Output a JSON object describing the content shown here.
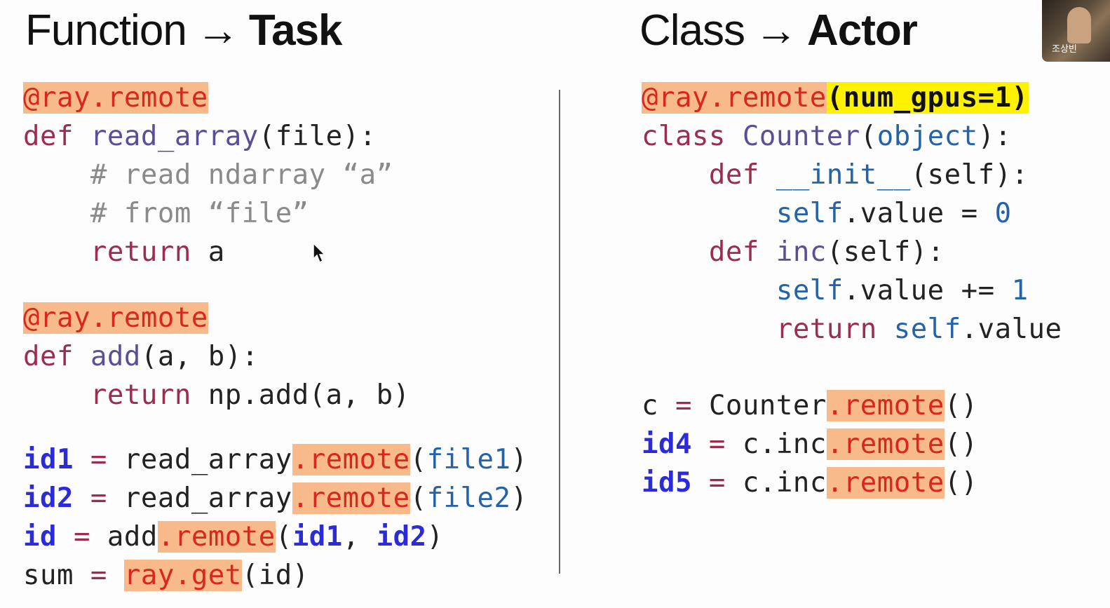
{
  "left": {
    "title_src": "Function",
    "title_arrow": "→",
    "title_dst": "Task",
    "decorator1": "@ray.remote",
    "fn1_def": "def",
    "fn1_name": "read_array",
    "fn1_sig": "(file):",
    "fn1_comment1": "# read ndarray “a”",
    "fn1_comment2": "# from “file”",
    "fn1_return": "return",
    "fn1_ret_val": "a",
    "decorator2": "@ray.remote",
    "fn2_def": "def",
    "fn2_name": "add",
    "fn2_sig": "(a, b):",
    "fn2_return": "return",
    "fn2_ret_val": "np.add(a, b)",
    "call1_var": "id1",
    "call1_eq": " = ",
    "call1_fn": "read_array",
    "call1_remote": ".remote",
    "call1_lp": "(",
    "call1_arg": "file1",
    "call1_rp": ")",
    "call2_var": "id2",
    "call2_eq": " = ",
    "call2_fn": "read_array",
    "call2_remote": ".remote",
    "call2_lp": "(",
    "call2_arg": "file2",
    "call2_rp": ")",
    "call3_var": "id",
    "call3_eq": " = ",
    "call3_fn": "add",
    "call3_remote": ".remote",
    "call3_lp": "(",
    "call3_arg1": "id1",
    "call3_sep": ", ",
    "call3_arg2": "id2",
    "call3_rp": ")",
    "call4_var": "sum",
    "call4_eq": " = ",
    "call4_fn": "ray.get",
    "call4_args": "(id)"
  },
  "right": {
    "title_src": "Class",
    "title_arrow": "→",
    "title_dst": "Actor",
    "decorator": "@ray.remote",
    "decorator_args": "(num_gpus=1)",
    "class_kw": "class",
    "class_name": "Counter",
    "class_lp": "(",
    "class_base": "object",
    "class_rp": "):",
    "init_def": "def",
    "init_name": "__init__",
    "init_sig": "(self):",
    "init_self": "self",
    "init_body": ".value = ",
    "init_zero": "0",
    "inc_def": "def",
    "inc_name": "inc",
    "inc_sig": "(self):",
    "inc_self": "self",
    "inc_body": ".value += ",
    "inc_one": "1",
    "inc_return": "return",
    "inc_ret_self": "self",
    "inc_ret_rest": ".value",
    "c_var": "c",
    "c_eq": " = ",
    "c_fn": "Counter",
    "c_remote": ".remote",
    "c_args": "()",
    "id4_var": "id4",
    "id4_eq": " = ",
    "id4_fn": "c.inc",
    "id4_remote": ".remote",
    "id4_args": "()",
    "id5_var": "id5",
    "id5_eq": " = ",
    "id5_fn": "c.inc",
    "id5_remote": ".remote",
    "id5_args": "()"
  },
  "participant": {
    "name": "조상빈"
  },
  "colors": {
    "keyword": "#9b2d4f",
    "function_name": "#5a4f96",
    "comment": "#8a8a8a",
    "builtin_blue": "#2463a8",
    "variable_bold_blue": "#2b2bd9",
    "remote_red": "#d9271e",
    "highlight_orange": "#f8b98b",
    "highlight_yellow": "#fff200"
  }
}
